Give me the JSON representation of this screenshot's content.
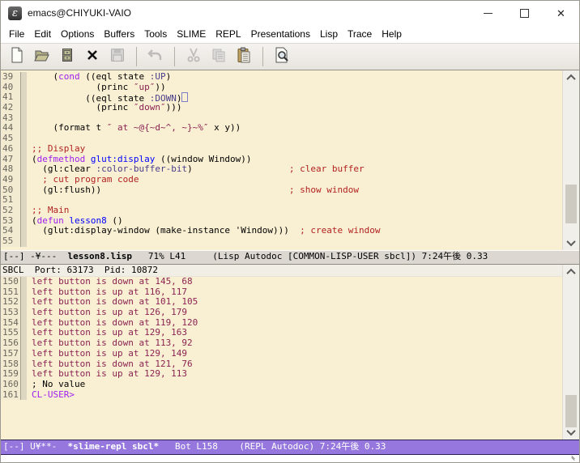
{
  "colors": {
    "titlebar_bg": "#ffffff",
    "buffer_bg": "#f9efd2",
    "linenum_bg": "#f3ead2",
    "linenum_fg": "#6b675c",
    "fringe_bg": "#ddd6c0",
    "keyword": "#a020f0",
    "function_name": "#0000ff",
    "builtin": "#483d8b",
    "string": "#8b2252",
    "comment": "#b22222",
    "output": "#8b2252",
    "prompt": "#a020f0",
    "modeline_inactive_bg": "#dcd8d1",
    "modeline_active_bg": "#9577dd",
    "modeline_active_fg": "#ffffff",
    "header_line_bg": "#f1eee5"
  },
  "window": {
    "title": "emacs@CHIYUKI-VAIO"
  },
  "menu_bar": {
    "items": [
      "File",
      "Edit",
      "Options",
      "Buffers",
      "Tools",
      "SLIME",
      "REPL",
      "Presentations",
      "Lisp",
      "Trace",
      "Help"
    ]
  },
  "toolbar": {
    "buttons": [
      {
        "name": "new-file",
        "disabled": false
      },
      {
        "name": "open-file",
        "disabled": false
      },
      {
        "name": "dired",
        "disabled": false
      },
      {
        "name": "close-buffer",
        "disabled": false
      },
      {
        "name": "save-buffer",
        "disabled": true
      },
      {
        "sep": true
      },
      {
        "name": "undo",
        "disabled": true
      },
      {
        "sep": true
      },
      {
        "name": "cut",
        "disabled": true
      },
      {
        "name": "copy",
        "disabled": true
      },
      {
        "name": "paste",
        "disabled": false
      },
      {
        "sep": true
      },
      {
        "name": "search",
        "disabled": false
      }
    ]
  },
  "code_buffer": {
    "lines": [
      {
        "n": 39,
        "seg": [
          [
            "    (",
            "p"
          ],
          [
            "cond",
            "k"
          ],
          [
            " ((eql state ",
            "p"
          ],
          [
            ":UP",
            "b"
          ],
          [
            ")",
            "p"
          ]
        ]
      },
      {
        "n": 40,
        "seg": [
          [
            "            (princ ",
            "p"
          ],
          [
            "″up″",
            "s"
          ],
          [
            "))",
            "p"
          ]
        ]
      },
      {
        "n": 41,
        "seg": [
          [
            "          ((eql state ",
            "p"
          ],
          [
            ":DOWN",
            "b"
          ],
          [
            ")",
            "p"
          ],
          [
            "",
            "cur"
          ]
        ]
      },
      {
        "n": 42,
        "seg": [
          [
            "            (princ ",
            "p"
          ],
          [
            "″down″",
            "s"
          ],
          [
            ")))",
            "p"
          ]
        ]
      },
      {
        "n": 43,
        "seg": []
      },
      {
        "n": 44,
        "seg": [
          [
            "    (format t ",
            "p"
          ],
          [
            "″ at ~@{~d~^, ~}~%″",
            "s"
          ],
          [
            " x y))",
            "p"
          ]
        ]
      },
      {
        "n": 45,
        "seg": []
      },
      {
        "n": 46,
        "seg": [
          [
            ";; Display",
            "c"
          ]
        ]
      },
      {
        "n": 47,
        "seg": [
          [
            "(",
            "p"
          ],
          [
            "defmethod",
            "k"
          ],
          [
            " ",
            "p"
          ],
          [
            "glut:display",
            "f"
          ],
          [
            " ((window Window))",
            "p"
          ]
        ]
      },
      {
        "n": 48,
        "seg": [
          [
            "  (gl:clear ",
            "p"
          ],
          [
            ":color-buffer-bit",
            "b"
          ],
          [
            ")",
            "p"
          ],
          [
            "                  ",
            "p"
          ],
          [
            "; clear buffer",
            "c"
          ]
        ]
      },
      {
        "n": 49,
        "seg": [
          [
            "  ",
            "p"
          ],
          [
            "; cut program code",
            "c"
          ]
        ]
      },
      {
        "n": 50,
        "seg": [
          [
            "  (gl:flush))",
            "p"
          ],
          [
            "                                   ",
            "p"
          ],
          [
            "; show window",
            "c"
          ]
        ]
      },
      {
        "n": 51,
        "seg": []
      },
      {
        "n": 52,
        "seg": [
          [
            ";; Main",
            "c"
          ]
        ]
      },
      {
        "n": 53,
        "seg": [
          [
            "(",
            "p"
          ],
          [
            "defun",
            "k"
          ],
          [
            " ",
            "p"
          ],
          [
            "lesson8",
            "f"
          ],
          [
            " ()",
            "p"
          ]
        ]
      },
      {
        "n": 54,
        "seg": [
          [
            "  (glut:display-window (make-instance 'Window)))",
            "p"
          ],
          [
            "  ",
            "p"
          ],
          [
            "; create window",
            "c"
          ]
        ]
      },
      {
        "n": 55,
        "seg": []
      }
    ]
  },
  "modeline_top": {
    "segments": [
      {
        "text": "[--] -¥---  ",
        "bold": false
      },
      {
        "text": "lesson8.lisp",
        "bold": true
      },
      {
        "text": "   71% L41     (Lisp Autodoc [COMMON-LISP-USER sbcl]) 7:24午後 0.33",
        "bold": false
      }
    ]
  },
  "repl": {
    "header": "SBCL  Port: 63173  Pid: 10872",
    "lines": [
      {
        "n": 150,
        "seg": [
          [
            "left button is down at 145, 68",
            "o"
          ]
        ]
      },
      {
        "n": 151,
        "seg": [
          [
            "left button is up at 116, 117",
            "o"
          ]
        ]
      },
      {
        "n": 152,
        "seg": [
          [
            "left button is down at 101, 105",
            "o"
          ]
        ]
      },
      {
        "n": 153,
        "seg": [
          [
            "left button is up at 126, 179",
            "o"
          ]
        ]
      },
      {
        "n": 154,
        "seg": [
          [
            "left button is down at 119, 120",
            "o"
          ]
        ]
      },
      {
        "n": 155,
        "seg": [
          [
            "left button is up at 129, 163",
            "o"
          ]
        ]
      },
      {
        "n": 156,
        "seg": [
          [
            "left button is down at 113, 92",
            "o"
          ]
        ]
      },
      {
        "n": 157,
        "seg": [
          [
            "left button is up at 129, 149",
            "o"
          ]
        ]
      },
      {
        "n": 158,
        "seg": [
          [
            "left button is down at 121, 76",
            "o"
          ]
        ]
      },
      {
        "n": 159,
        "seg": [
          [
            "left button is up at 129, 113",
            "o"
          ]
        ]
      },
      {
        "n": 160,
        "seg": [
          [
            "; No value",
            "p"
          ]
        ]
      },
      {
        "n": 161,
        "seg": [
          [
            "CL-USER>",
            "prm"
          ]
        ]
      }
    ]
  },
  "modeline_bottom": {
    "segments": [
      {
        "text": "[--] U¥**-  ",
        "bold": false
      },
      {
        "text": "*slime-repl sbcl*",
        "bold": true
      },
      {
        "text": "   Bot L158    (REPL Autodoc) 7:24午後 0.33",
        "bold": false
      }
    ]
  }
}
